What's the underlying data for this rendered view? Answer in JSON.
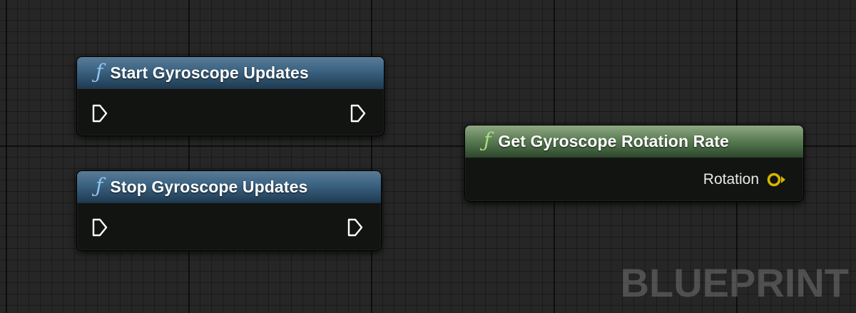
{
  "graph": {
    "watermark": "BLUEPRINT",
    "nodes": [
      {
        "id": "start-gyroscope-updates",
        "title": "Start Gyroscope Updates",
        "kind": "function",
        "header_color": "#3d6584",
        "icon": "function-icon",
        "pins": [
          {
            "name": "exec-in",
            "direction": "input",
            "type": "exec"
          },
          {
            "name": "exec-out",
            "direction": "output",
            "type": "exec"
          }
        ]
      },
      {
        "id": "stop-gyroscope-updates",
        "title": "Stop Gyroscope Updates",
        "kind": "function",
        "header_color": "#3d6584",
        "icon": "function-icon",
        "pins": [
          {
            "name": "exec-in",
            "direction": "input",
            "type": "exec"
          },
          {
            "name": "exec-out",
            "direction": "output",
            "type": "exec"
          }
        ]
      },
      {
        "id": "get-gyroscope-rotation-rate",
        "title": "Get Gyroscope Rotation Rate",
        "kind": "pure-function",
        "header_color": "#62835a",
        "icon": "function-icon",
        "pins": [
          {
            "name": "Rotation",
            "direction": "output",
            "type": "rotator",
            "color": "#d8b400"
          }
        ]
      }
    ]
  },
  "icons": {
    "function_glyph": "ƒ"
  },
  "colors": {
    "background": "#262626",
    "node_body": "#121412",
    "function_header": "#3d6584",
    "pure_function_header": "#62835a",
    "rotator_pin": "#d8b400",
    "exec_pin": "#ffffff"
  }
}
